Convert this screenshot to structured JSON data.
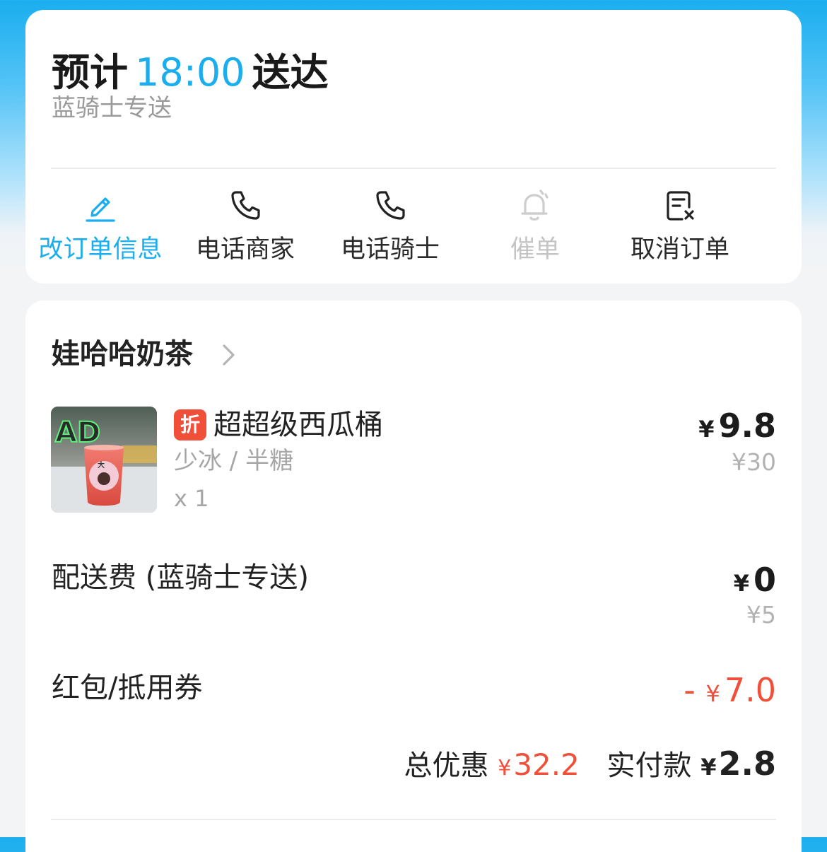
{
  "delivery": {
    "eta_prefix": "预计",
    "eta_time": "18:00",
    "eta_suffix": "送达",
    "rider_type": "蓝骑士专送"
  },
  "actions": [
    {
      "label": "改订单信息",
      "icon": "edit-icon",
      "state": "active"
    },
    {
      "label": "电话商家",
      "icon": "phone-icon",
      "state": "normal"
    },
    {
      "label": "电话骑士",
      "icon": "phone-icon",
      "state": "normal"
    },
    {
      "label": "催单",
      "icon": "bell-icon",
      "state": "disabled"
    },
    {
      "label": "取消订单",
      "icon": "cancel-order-icon",
      "state": "normal"
    }
  ],
  "shop": {
    "name": "娃哈哈奶茶"
  },
  "item": {
    "discount_tag": "折",
    "name": "超超级西瓜桶",
    "spec": "少冰 / 半糖",
    "qty": "x 1",
    "currency": "¥",
    "price": "9.8",
    "original_price": "¥30"
  },
  "delivery_fee": {
    "label": "配送费 (蓝骑士专送)",
    "currency": "¥",
    "price": "0",
    "original_price": "¥5"
  },
  "coupon": {
    "label": "红包/抵用券",
    "sign": "-",
    "currency": "¥",
    "amount": "7.0"
  },
  "totals": {
    "discount_label": "总优惠",
    "discount_currency": "¥",
    "discount_value": "32.2",
    "paid_label": "实付款",
    "paid_currency": "¥",
    "paid_value": "2.8"
  },
  "colors": {
    "accent": "#1aaeef",
    "discount_red": "#f04f3a",
    "muted": "#9a9a9a"
  }
}
